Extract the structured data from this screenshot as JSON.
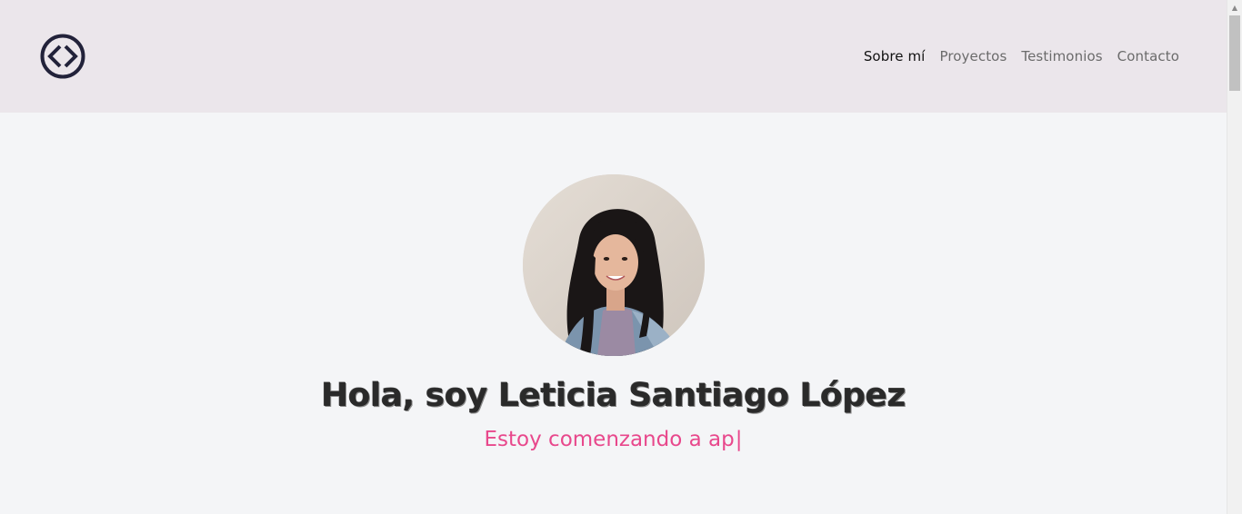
{
  "header": {
    "logo_icon": "code-brackets-icon",
    "nav": [
      {
        "label": "Sobre mí",
        "active": true
      },
      {
        "label": "Proyectos",
        "active": false
      },
      {
        "label": "Testimonios",
        "active": false
      },
      {
        "label": "Contacto",
        "active": false
      }
    ]
  },
  "hero": {
    "avatar_icon": "profile-photo",
    "title": "Hola, soy Leticia Santiago López",
    "subtitle": "Estoy comenzando a ap",
    "cursor": "|"
  },
  "colors": {
    "header_bg": "#ebe6eb",
    "page_bg": "#f4f5f7",
    "accent": "#e8488c",
    "title": "#2a2a2a",
    "nav_active": "#111111",
    "nav_inactive": "#6b6b6b"
  }
}
